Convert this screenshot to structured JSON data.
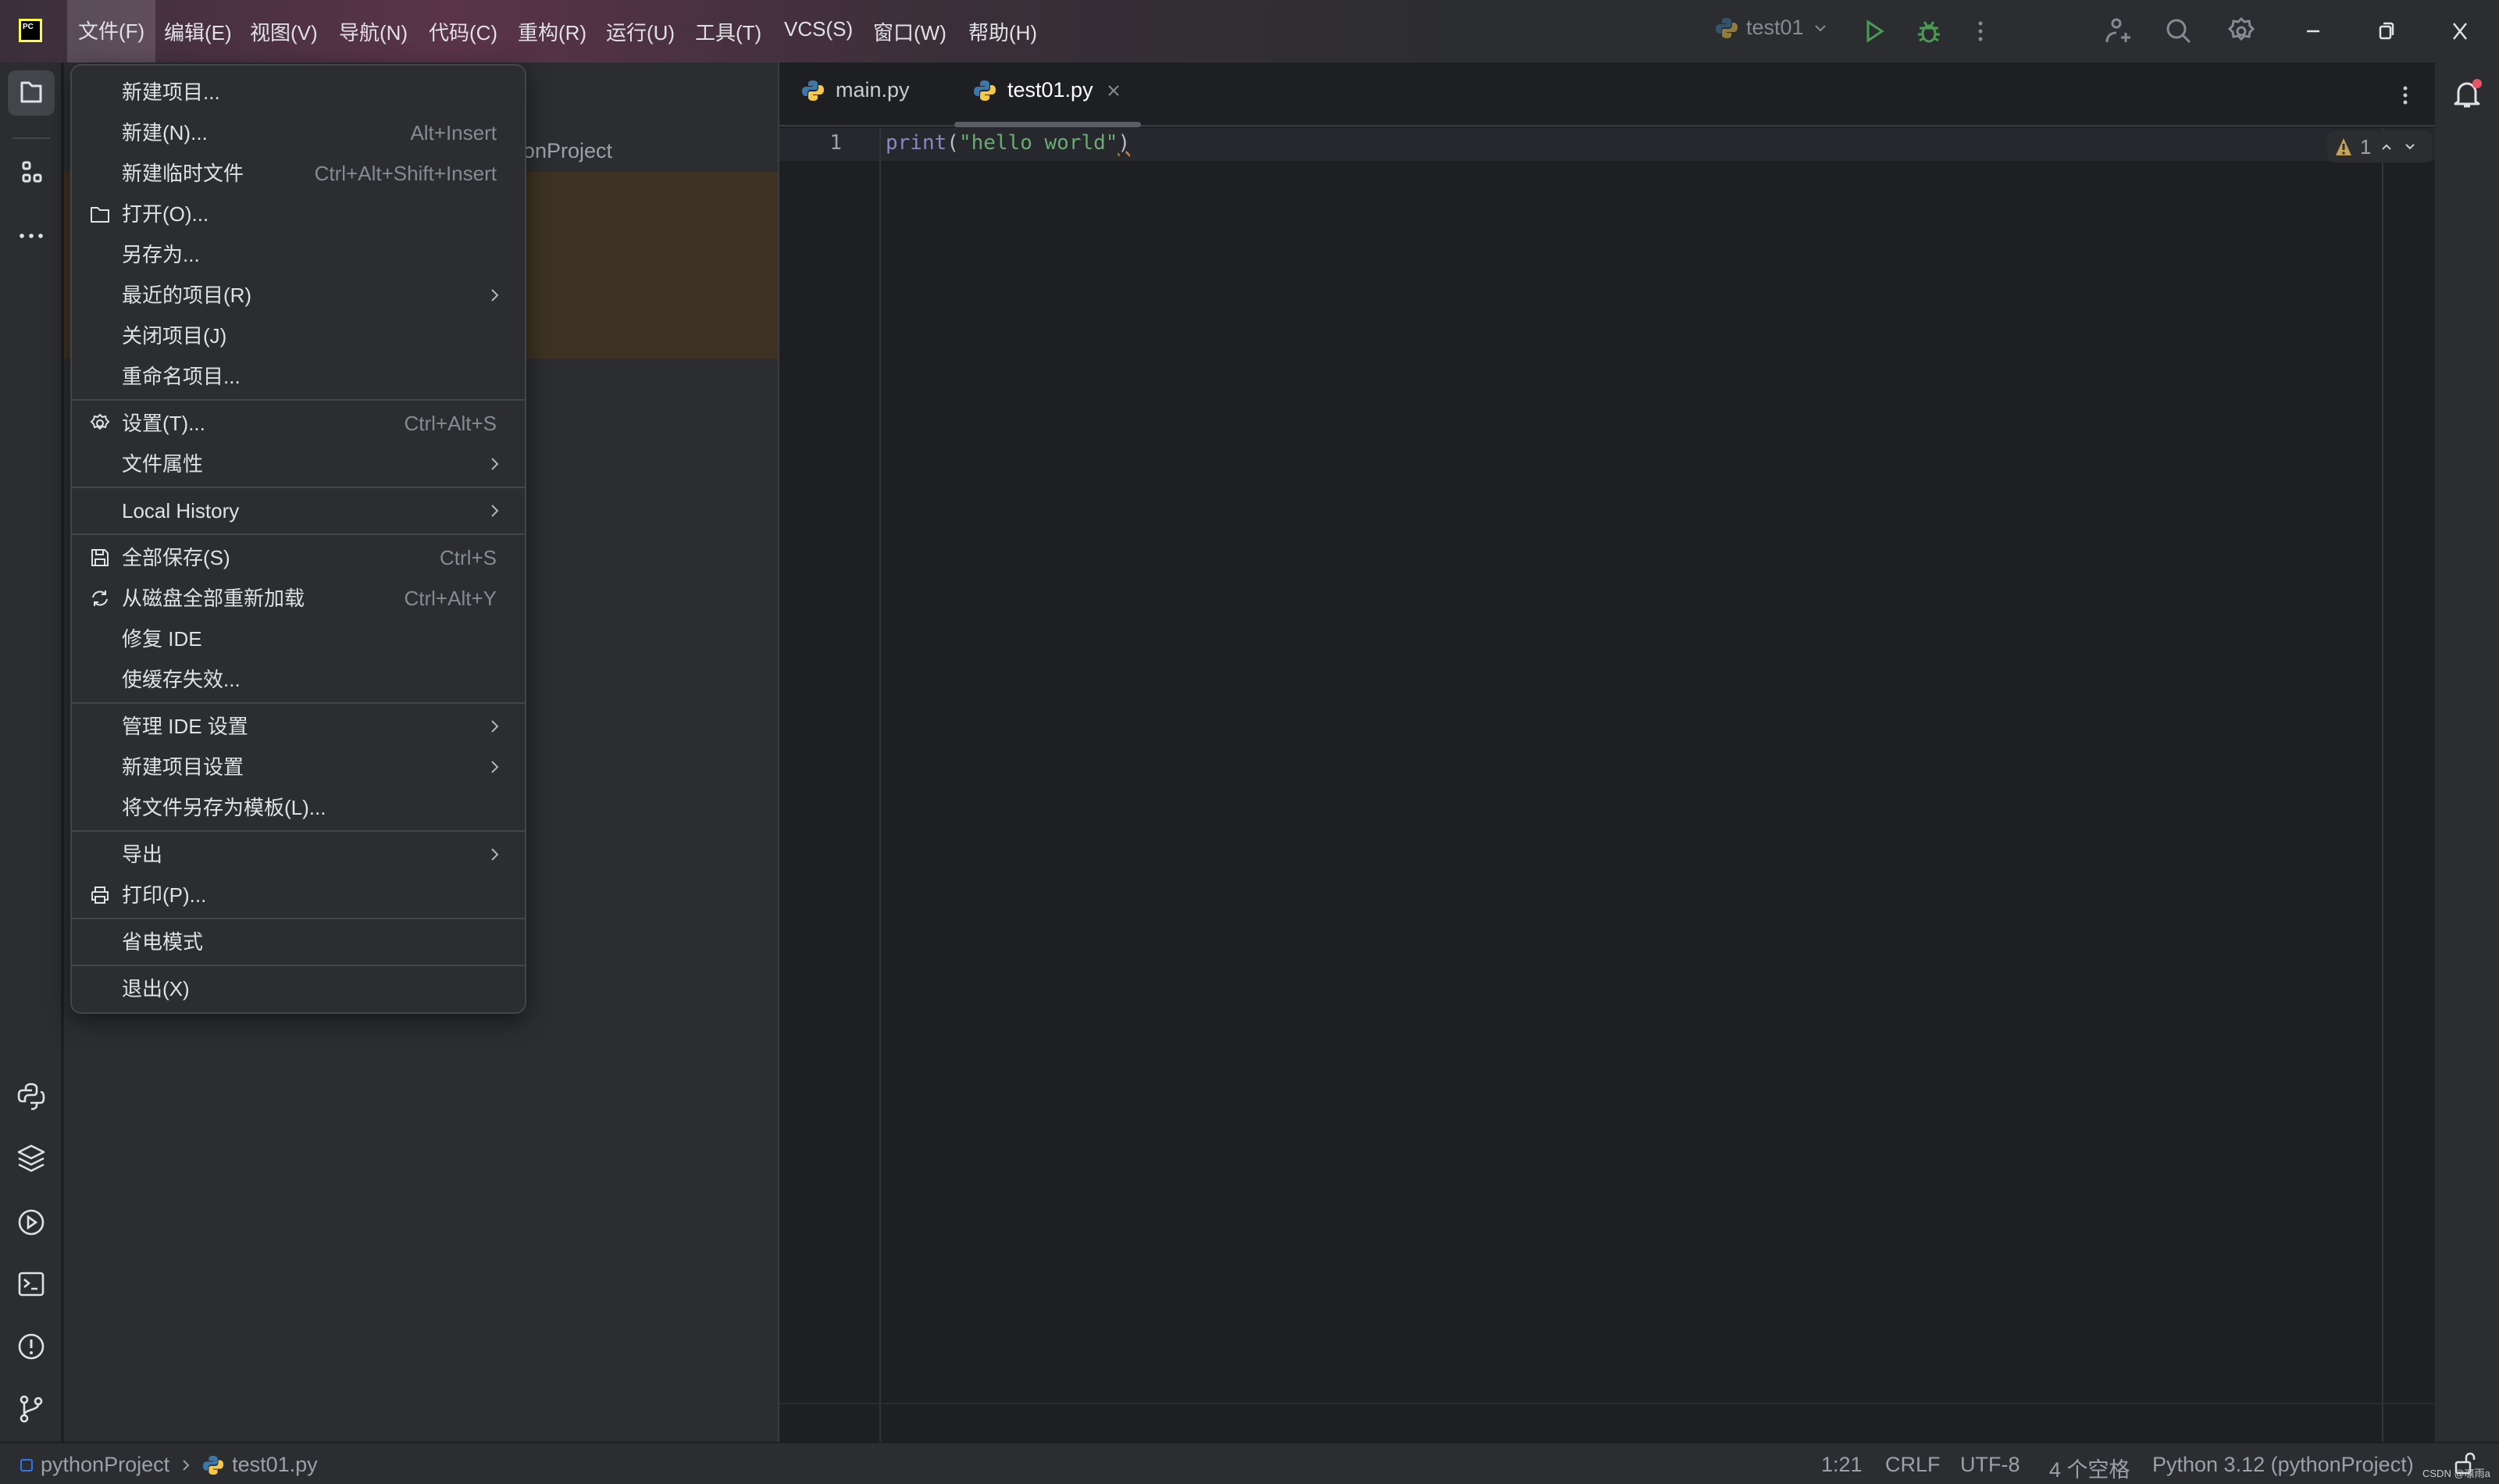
{
  "titlebar": {
    "menus": [
      "文件(F)",
      "编辑(E)",
      "视图(V)",
      "导航(N)",
      "代码(C)",
      "重构(R)",
      "运行(U)",
      "工具(T)",
      "VCS(S)",
      "窗口(W)",
      "帮助(H)"
    ],
    "run_config": "test01",
    "logo_text": "PC"
  },
  "project_panel": {
    "title_fragment": "pythonProject"
  },
  "editor": {
    "tabs": [
      {
        "label": "main.py",
        "active": false
      },
      {
        "label": "test01.py",
        "active": true
      }
    ],
    "lines": [
      {
        "number": "1",
        "code_func": "print",
        "code_open": "(",
        "code_string": "\"hello world\"",
        "code_close": ")"
      }
    ],
    "warnings_count": "1"
  },
  "file_menu": {
    "groups": [
      [
        {
          "label": "新建项目...",
          "shortcut": "",
          "submenu": false,
          "icon": ""
        },
        {
          "label": "新建(N)...",
          "shortcut": "Alt+Insert",
          "submenu": false,
          "icon": ""
        },
        {
          "label": "新建临时文件",
          "shortcut": "Ctrl+Alt+Shift+Insert",
          "submenu": false,
          "icon": ""
        },
        {
          "label": "打开(O)...",
          "shortcut": "",
          "submenu": false,
          "icon": "folder-icon"
        },
        {
          "label": "另存为...",
          "shortcut": "",
          "submenu": false,
          "icon": ""
        },
        {
          "label": "最近的项目(R)",
          "shortcut": "",
          "submenu": true,
          "icon": ""
        },
        {
          "label": "关闭项目(J)",
          "shortcut": "",
          "submenu": false,
          "icon": ""
        },
        {
          "label": "重命名项目...",
          "shortcut": "",
          "submenu": false,
          "icon": ""
        }
      ],
      [
        {
          "label": "设置(T)...",
          "shortcut": "Ctrl+Alt+S",
          "submenu": false,
          "icon": "gear-icon"
        },
        {
          "label": "文件属性",
          "shortcut": "",
          "submenu": true,
          "icon": ""
        }
      ],
      [
        {
          "label": "Local History",
          "shortcut": "",
          "submenu": true,
          "icon": ""
        }
      ],
      [
        {
          "label": "全部保存(S)",
          "shortcut": "Ctrl+S",
          "submenu": false,
          "icon": "save-icon"
        },
        {
          "label": "从磁盘全部重新加载",
          "shortcut": "Ctrl+Alt+Y",
          "submenu": false,
          "icon": "reload-icon"
        },
        {
          "label": "修复 IDE",
          "shortcut": "",
          "submenu": false,
          "icon": ""
        },
        {
          "label": "使缓存失效...",
          "shortcut": "",
          "submenu": false,
          "icon": ""
        }
      ],
      [
        {
          "label": "管理 IDE 设置",
          "shortcut": "",
          "submenu": true,
          "icon": ""
        },
        {
          "label": "新建项目设置",
          "shortcut": "",
          "submenu": true,
          "icon": ""
        },
        {
          "label": "将文件另存为模板(L)...",
          "shortcut": "",
          "submenu": false,
          "icon": ""
        }
      ],
      [
        {
          "label": "导出",
          "shortcut": "",
          "submenu": true,
          "icon": ""
        },
        {
          "label": "打印(P)...",
          "shortcut": "",
          "submenu": false,
          "icon": "print-icon"
        }
      ],
      [
        {
          "label": "省电模式",
          "shortcut": "",
          "submenu": false,
          "icon": ""
        }
      ],
      [
        {
          "label": "退出(X)",
          "shortcut": "",
          "submenu": false,
          "icon": ""
        }
      ]
    ]
  },
  "statusbar": {
    "project": "pythonProject",
    "file": "test01.py",
    "position": "1:21",
    "line_separator": "CRLF",
    "encoding": "UTF-8",
    "indent": "4 个空格",
    "interpreter": "Python 3.12 (pythonProject)",
    "watermark": "CSDN @凛雨a"
  },
  "colors": {
    "accent": "#3574f0",
    "run_green": "#499c54",
    "string_green": "#6aab73",
    "keyword_purple": "#8888c6",
    "warning": "#f2c55c",
    "notification_red": "#e55765",
    "highlight": "#3d3223"
  }
}
